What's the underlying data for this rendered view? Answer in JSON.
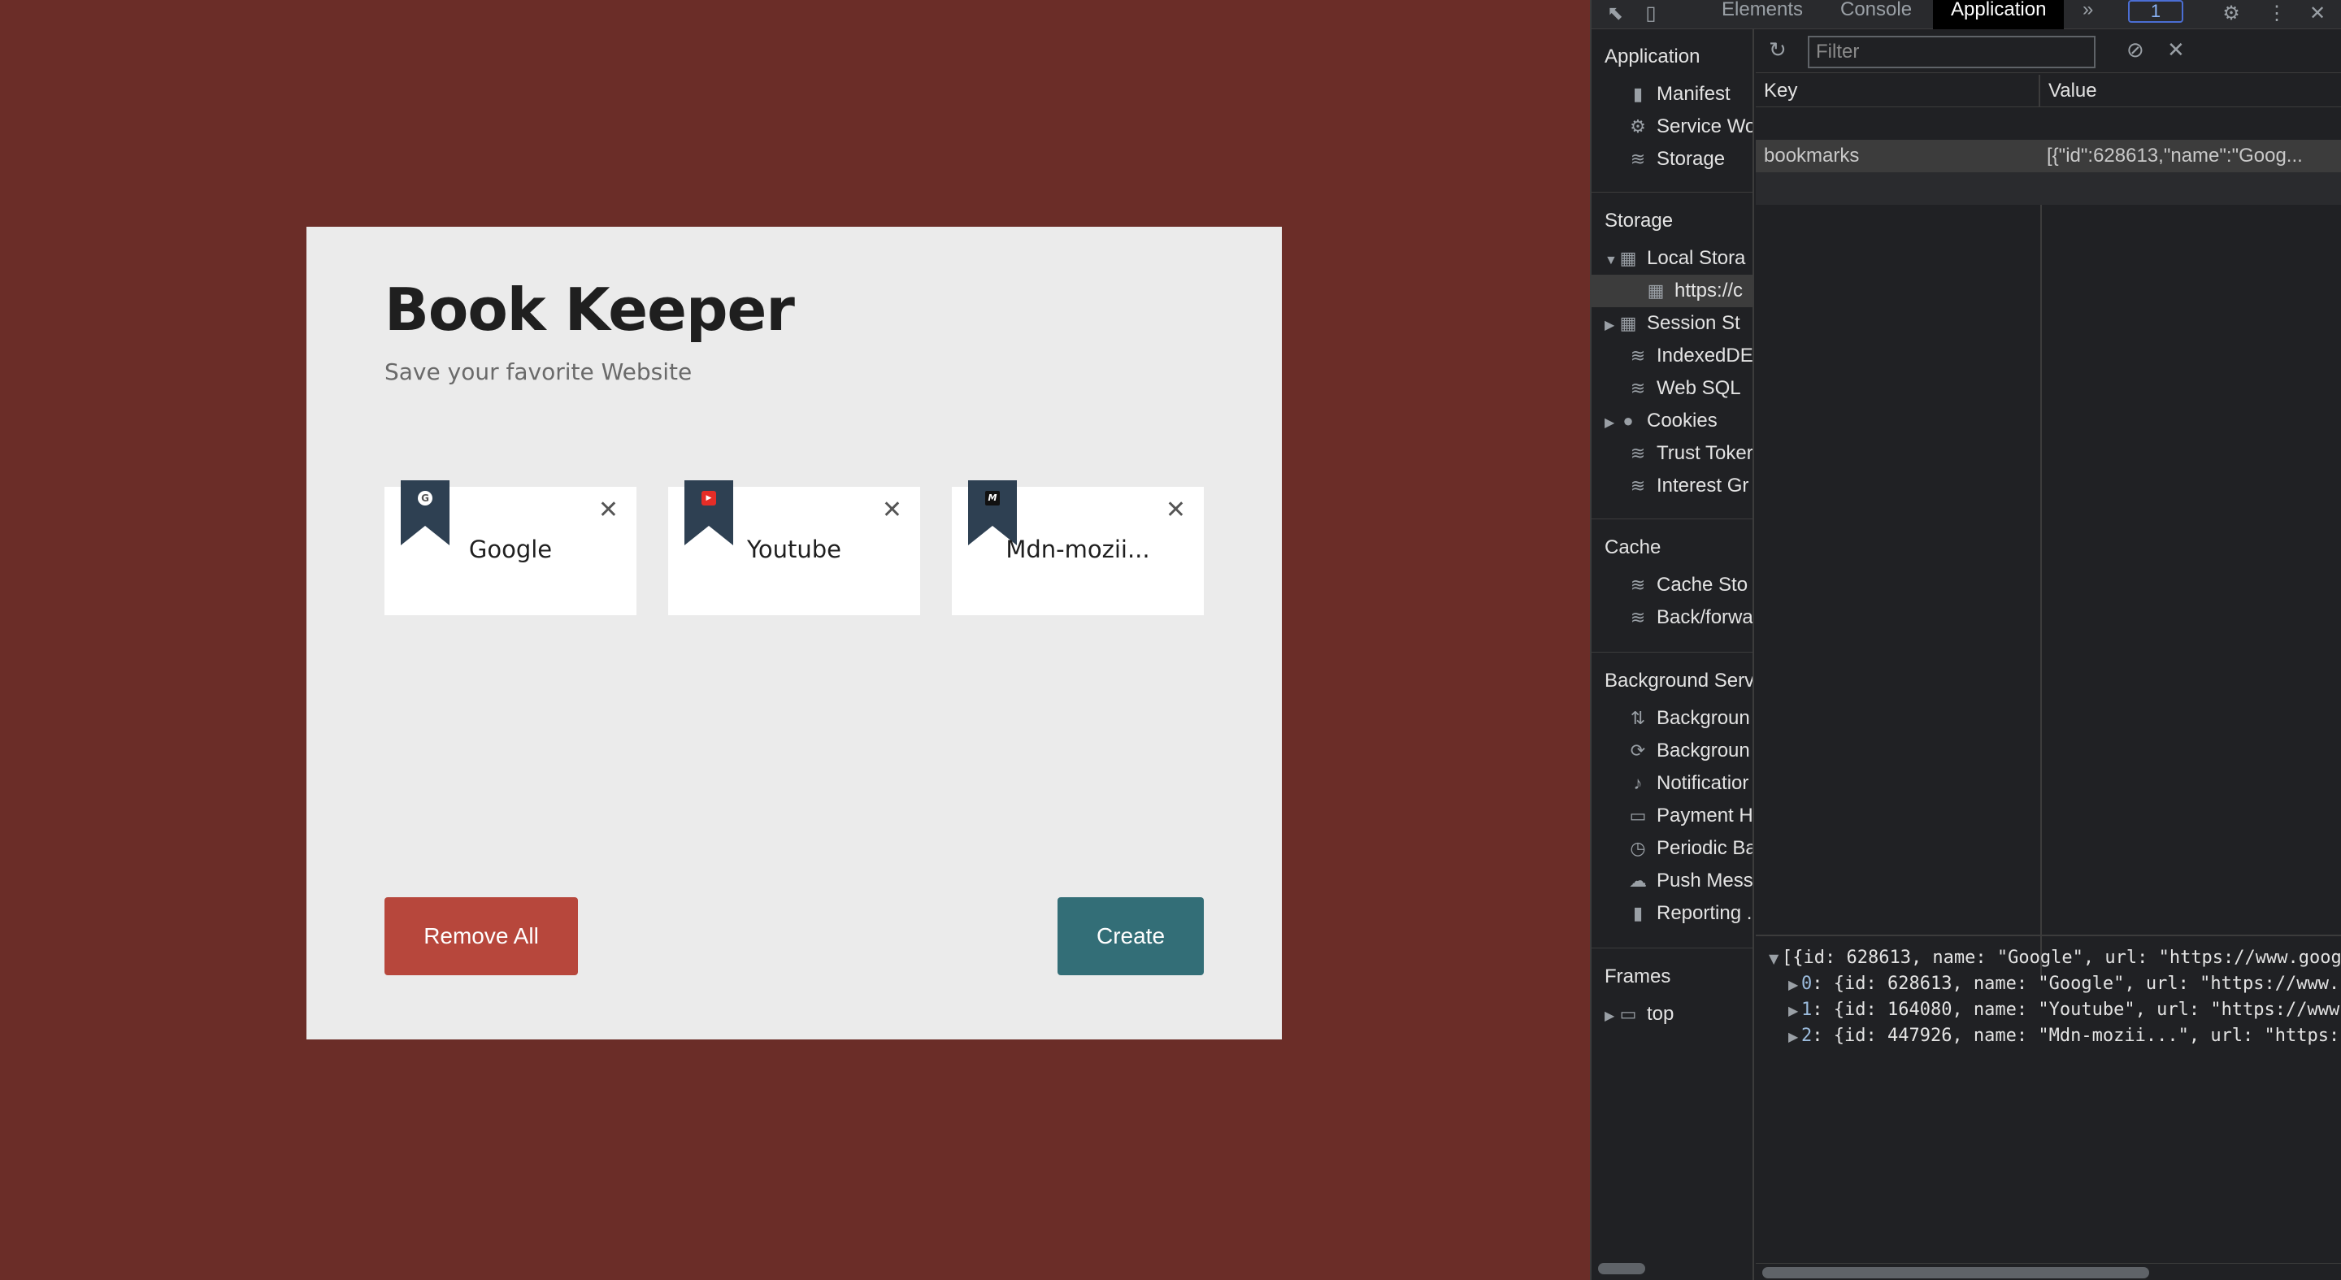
{
  "app": {
    "title": "Book Keeper",
    "subtitle": "Save your favorite Website",
    "bookmarks": [
      {
        "name": "Google",
        "favicon": "G"
      },
      {
        "name": "Youtube",
        "favicon": "▶"
      },
      {
        "name": "Mdn-mozii...",
        "favicon": "M"
      }
    ],
    "close_glyph": "✕",
    "remove_all_label": "Remove All",
    "create_label": "Create",
    "colors": {
      "background": "#6b2d28",
      "card": "#ebebeb",
      "ribbon": "#2e4052",
      "remove": "#b7473c",
      "create": "#336e77"
    }
  },
  "devtools": {
    "tabs": {
      "elements": "Elements",
      "console": "Console",
      "application": "Application",
      "more": "»"
    },
    "badge": "1",
    "sidebar": {
      "application_header": "Application",
      "application_items": [
        "Manifest",
        "Service Wo",
        "Storage"
      ],
      "storage_header": "Storage",
      "local_storage": "Local Stora",
      "local_storage_origin": "https://c",
      "storage_items": [
        "Session St",
        "IndexedDE",
        "Web SQL",
        "Cookies",
        "Trust Toker",
        "Interest Gr"
      ],
      "cache_header": "Cache",
      "cache_items": [
        "Cache Sto",
        "Back/forwa"
      ],
      "background_header": "Background Serv",
      "background_items": [
        "Backgroun",
        "Backgroun",
        "Notificatior",
        "Payment H",
        "Periodic Ba",
        "Push Mess",
        "Reporting ."
      ],
      "frames_header": "Frames",
      "frames_top": "top"
    },
    "filter_placeholder": "Filter",
    "columns": {
      "key": "Key",
      "value": "Value"
    },
    "rows": [
      {
        "key": "bookmarks",
        "value": "[{\"id\":628613,\"name\":\"Goog..."
      }
    ],
    "preview": {
      "root": "[{id: 628613, name: \"Google\", url: \"https://www.goog",
      "items": [
        {
          "idx": "0",
          "text": ": {id: 628613, name: \"Google\", url: \"https://www."
        },
        {
          "idx": "1",
          "text": ": {id: 164080, name: \"Youtube\", url: \"https://www"
        },
        {
          "idx": "2",
          "text": ": {id: 447926, name: \"Mdn-mozii...\", url: \"https:"
        }
      ]
    }
  }
}
